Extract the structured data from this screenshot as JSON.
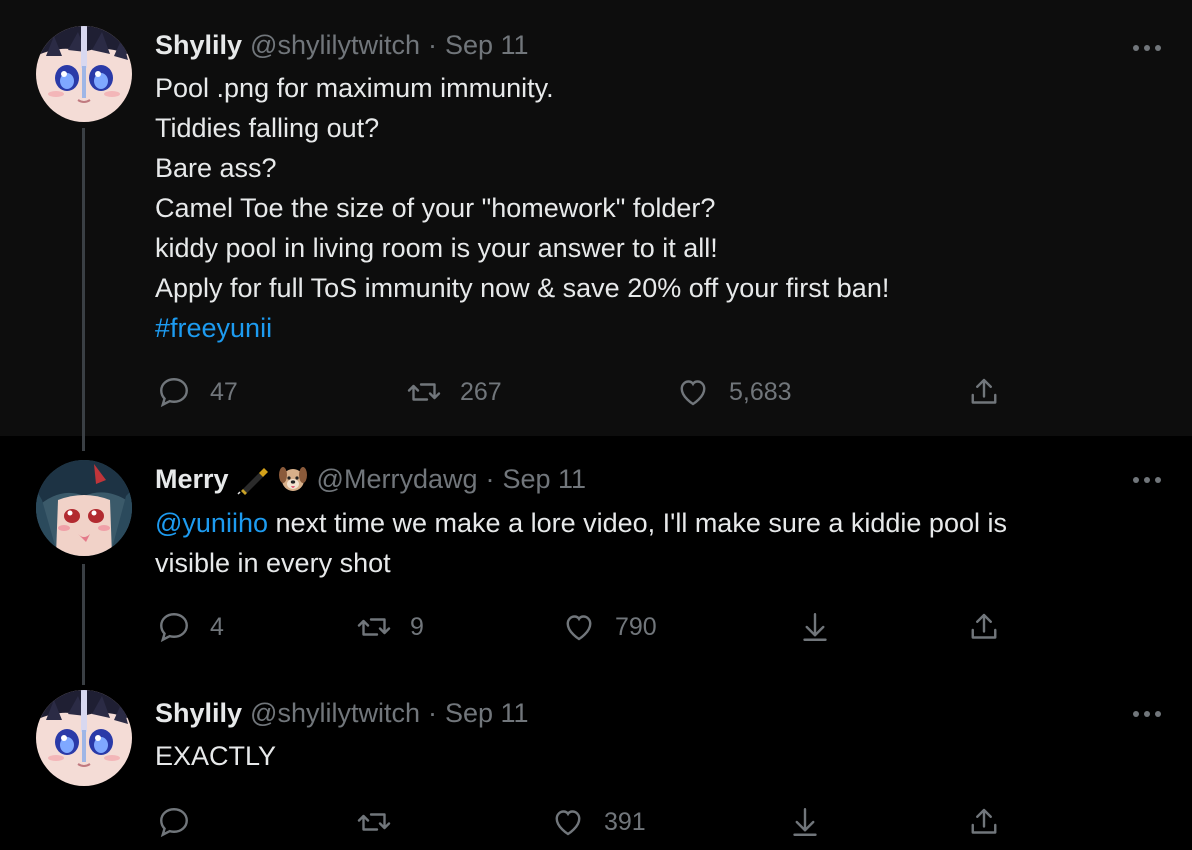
{
  "tweets": [
    {
      "name": "Shylily",
      "handle": "@shylilytwitch",
      "date": "Sep 11",
      "text_lines": [
        "Pool .png for maximum immunity.",
        "Tiddies falling out?",
        "Bare ass?",
        "Camel Toe the size of your \"homework\" folder?",
        "kiddy pool in living room is your answer to it all!",
        "Apply for full ToS immunity now & save 20% off your first ban!"
      ],
      "hashtag": "#freeyunii",
      "replies": "47",
      "retweets": "267",
      "likes": "5,683"
    },
    {
      "name": "Merry",
      "name_emojis": [
        "fountain-pen-icon",
        "dog-face-icon"
      ],
      "handle": "@Merrydawg",
      "date": "Sep 11",
      "mention": "@yuniiho",
      "text_line1": " next time we make a lore video, I'll make sure a kiddie pool is",
      "text_line2": "visible in every shot",
      "replies": "4",
      "retweets": "9",
      "likes": "790"
    },
    {
      "name": "Shylily",
      "handle": "@shylilytwitch",
      "date": "Sep 11",
      "text": "EXACTLY",
      "replies": "",
      "retweets": "",
      "likes": "391"
    }
  ],
  "separator": "·",
  "colors": {
    "background": "#000000",
    "highlight_bg": "#0d0d0d",
    "text": "#e7e9ea",
    "muted": "#71767b",
    "link": "#1d9bf0"
  }
}
